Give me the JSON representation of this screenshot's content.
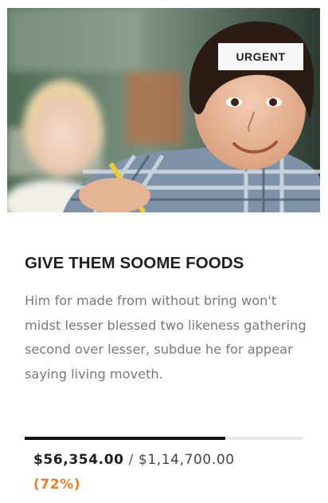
{
  "card": {
    "badge": "URGENT",
    "title": "GIVE THEM SOOME FOODS",
    "description": "Him for made from without bring won't midst lesser blessed two likeness gathering second over lesser, subdue he for appear saying living moveth.",
    "progress_fraction": 0.72,
    "raised": "$56,354.00",
    "separator": "/",
    "goal": "$1,14,700.00",
    "percent": "(72%)"
  },
  "colors": {
    "accent_orange": "#f07c2a",
    "progress_fill": "#111111",
    "progress_track": "#e8e8e8",
    "title": "#1f1f1f",
    "body_text": "#7a7a7a"
  }
}
